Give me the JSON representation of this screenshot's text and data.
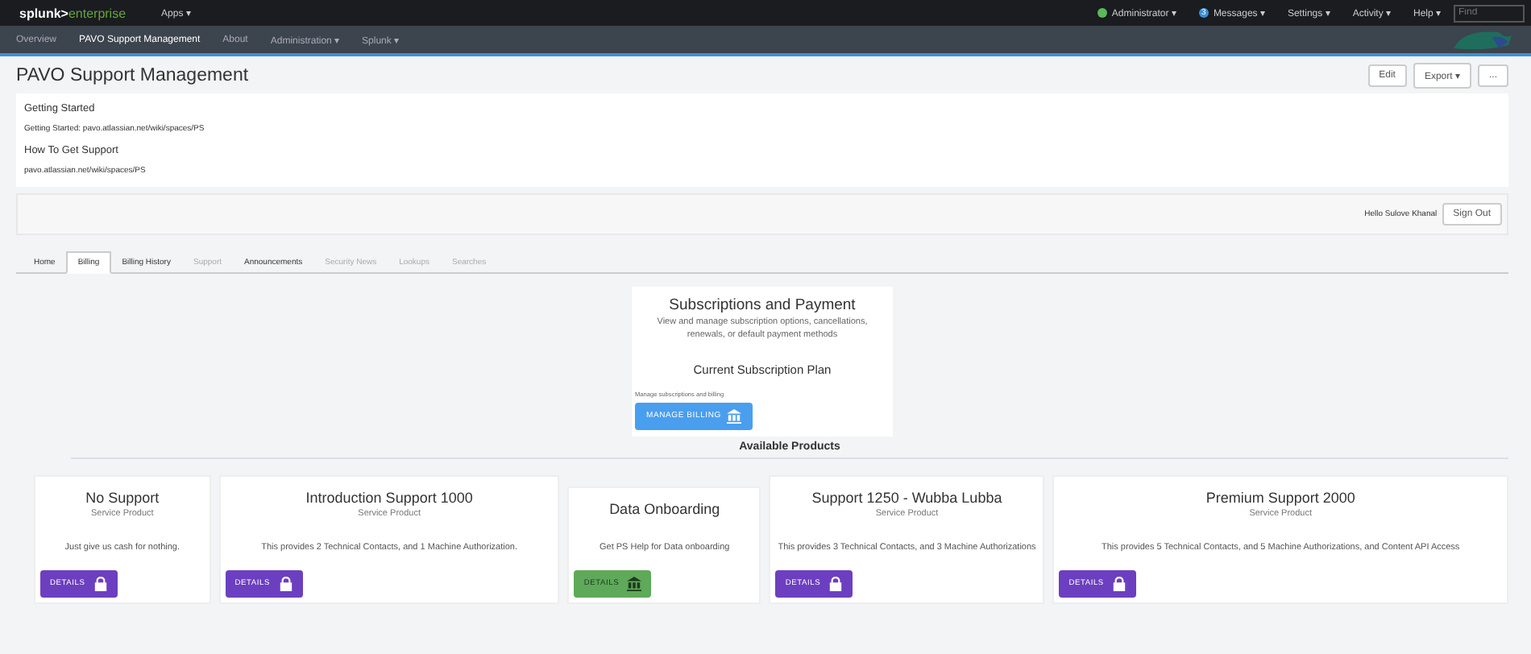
{
  "top_bar": {
    "logo_brand": "splunk>",
    "logo_product": "enterprise",
    "apps_menu": "Apps ▾",
    "menus": [
      {
        "label": "Administrator ▾",
        "color": "#5cb85c"
      },
      {
        "label": "Messages ▾",
        "badge": "3",
        "color": "#3c8fd6"
      },
      {
        "label": "Settings ▾"
      },
      {
        "label": "Activity ▾"
      },
      {
        "label": "Help ▾"
      }
    ],
    "find_placeholder": "Find"
  },
  "app_bar": {
    "items": [
      {
        "label": "Overview",
        "selected": false
      },
      {
        "label": "PAVO Support Management",
        "selected": true
      },
      {
        "label": "About",
        "selected": false
      },
      {
        "label": "Administration ▾",
        "selected": false
      },
      {
        "label": "Splunk ▾",
        "selected": false
      }
    ]
  },
  "dashboard": {
    "title": "PAVO Support Management",
    "actions": [
      "Edit",
      "Export ▾",
      "..."
    ]
  },
  "info_panel": [
    {
      "kind": "heading",
      "text": "Getting Started"
    },
    {
      "kind": "small",
      "text": "Getting Started: pavo.atlassian.net/wiki/spaces/PS"
    },
    {
      "kind": "heading",
      "text": "How To Get Support"
    },
    {
      "kind": "small",
      "text": "pavo.atlassian.net/wiki/spaces/PS"
    }
  ],
  "user_panel": {
    "greeting": "Hello Sulove Khanal",
    "sign_out": "Sign Out"
  },
  "tabs": [
    {
      "label": "Home",
      "selected": false,
      "disabled": false
    },
    {
      "label": "Billing",
      "selected": true,
      "disabled": false
    },
    {
      "label": "Billing History",
      "selected": false,
      "disabled": false
    },
    {
      "label": "Support",
      "selected": false,
      "disabled": true
    },
    {
      "label": "Announcements",
      "selected": false,
      "disabled": false
    },
    {
      "label": "Security News",
      "selected": false,
      "disabled": true
    },
    {
      "label": "Lookups",
      "selected": false,
      "disabled": true
    },
    {
      "label": "Searches",
      "selected": false,
      "disabled": true
    }
  ],
  "subscription_card": {
    "title": "Subscriptions and Payment",
    "description": "View and manage subscription options, cancellations, renewals, or default payment methods",
    "plan_heading": "Current Subscription Plan",
    "note": "Manage subscriptions and billing",
    "button": "MANAGE BILLING"
  },
  "products_heading": "Available Products",
  "products": [
    {
      "name": "No Support",
      "subtitle": "Service Product",
      "description": "Just give us cash for nothing.",
      "button": "DETAILS",
      "kind": "locked"
    },
    {
      "name": "Introduction Support 1000",
      "subtitle": "Service Product",
      "description": "This provides 2 Technical Contacts, and 1 Machine Authorization.",
      "button": "DETAILS",
      "kind": "locked"
    },
    {
      "name": "Data Onboarding",
      "description": "Get PS Help for Data onboarding",
      "button": "DETAILS",
      "kind": "open"
    },
    {
      "name": "Support 1250 - Wubba Lubba",
      "subtitle": "Service Product",
      "description": "This provides 3 Technical Contacts, and 3 Machine Authorizations",
      "button": "DETAILS",
      "kind": "locked"
    },
    {
      "name": "Premium Support 2000",
      "subtitle": "Service Product",
      "description": "This provides 5 Technical Contacts, and 5 Machine Authorizations, and Content API Access",
      "button": "DETAILS",
      "kind": "locked"
    }
  ]
}
